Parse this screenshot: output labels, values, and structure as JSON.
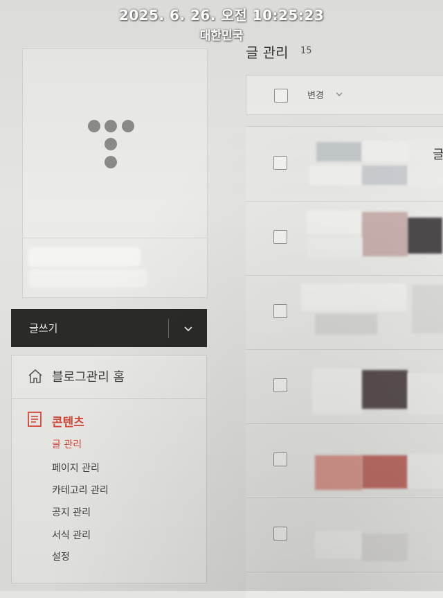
{
  "watermark": {
    "datetime": "2025. 6. 26. 오전 10:25:23",
    "location": "대한민국"
  },
  "sidebar": {
    "write_button": {
      "label": "글쓰기",
      "dropdown_icon": "chevron-down-icon"
    },
    "home": {
      "label": "블로그관리 홈",
      "icon": "home-icon"
    },
    "section": {
      "label": "콘텐츠",
      "icon": "document-icon",
      "items": [
        {
          "label": "글 관리",
          "active": true
        },
        {
          "label": "페이지 관리",
          "active": false
        },
        {
          "label": "카테고리 관리",
          "active": false
        },
        {
          "label": "공지 관리",
          "active": false
        },
        {
          "label": "서식 관리",
          "active": false
        },
        {
          "label": "설정",
          "active": false
        }
      ]
    }
  },
  "main": {
    "title": "글 관리",
    "count": "15",
    "toolbar": {
      "change_label": "변경"
    },
    "first_row_partial_text": "글"
  },
  "colors": {
    "accent": "#d9493a",
    "write_bar": "#2b2b2a"
  }
}
